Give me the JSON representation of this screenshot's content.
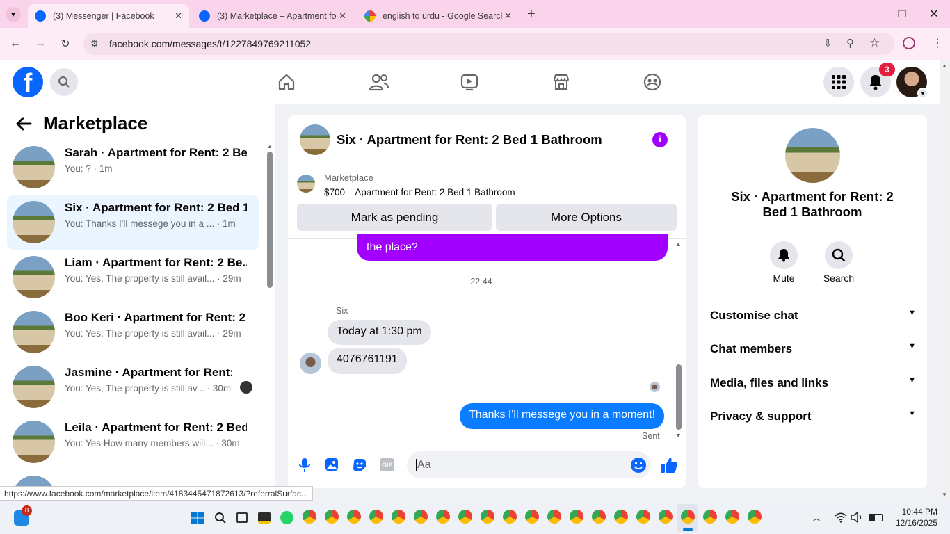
{
  "browser": {
    "tabs": [
      {
        "title": "(3) Messenger | Facebook"
      },
      {
        "title": "(3) Marketplace – Apartment fo"
      },
      {
        "title": "english to urdu - Google Search"
      }
    ],
    "url": "facebook.com/messages/t/1227849769211052",
    "status_url": "https://www.facebook.com/marketplace/item/4183445471872613/?referralSurfac..."
  },
  "header": {
    "notification_count": "3"
  },
  "left": {
    "title": "Marketplace",
    "conversations": [
      {
        "name": "Sarah · Apartment for Rent: 2 Be...",
        "preview": "You: ? · 1m"
      },
      {
        "name": "Six · Apartment for Rent: 2 Bed 1...",
        "preview": "You: Thanks I'll messege you in a ...  · 1m"
      },
      {
        "name": "Liam · Apartment for Rent: 2 Be...",
        "preview": "You: Yes, The property is still avail... · 29m"
      },
      {
        "name": "Boo Keri · Apartment for Rent: 2 ...",
        "preview": "You: Yes, The property is still avail... · 29m"
      },
      {
        "name": "Jasmine · Apartment for Rent:...",
        "preview": "You: Yes, The property is still av... · 30m"
      },
      {
        "name": "Leila · Apartment for Rent: 2 Bed...",
        "preview": "You: Yes How many members will... · 30m"
      }
    ]
  },
  "chat": {
    "title": "Six · Apartment for Rent: 2 Bed 1 Bathroom",
    "listing_source": "Marketplace",
    "listing_title": "$700 – Apartment for Rent: 2 Bed 1 Bathroom",
    "mark_pending": "Mark as pending",
    "more_options": "More Options",
    "prev_bubble": "the place?",
    "timestamp": "22:44",
    "sender": "Six",
    "msg1": "Today at 1:30 pm",
    "msg2": "4076761191",
    "my_msg": "Thanks I'll messege you in a moment!",
    "sent": "Sent",
    "input_placeholder": "Aa"
  },
  "right": {
    "title": "Six · Apartment for Rent: 2 Bed 1 Bathroom",
    "mute": "Mute",
    "search": "Search",
    "sections": [
      "Customise chat",
      "Chat members",
      "Media, files and links",
      "Privacy & support"
    ]
  },
  "taskbar": {
    "badge": "8",
    "time": "10:44 PM",
    "date": "12/16/2025"
  },
  "colors": {
    "fb_blue": "#0866ff",
    "purple": "#a100ff",
    "messenger_blue": "#0a7cff"
  }
}
